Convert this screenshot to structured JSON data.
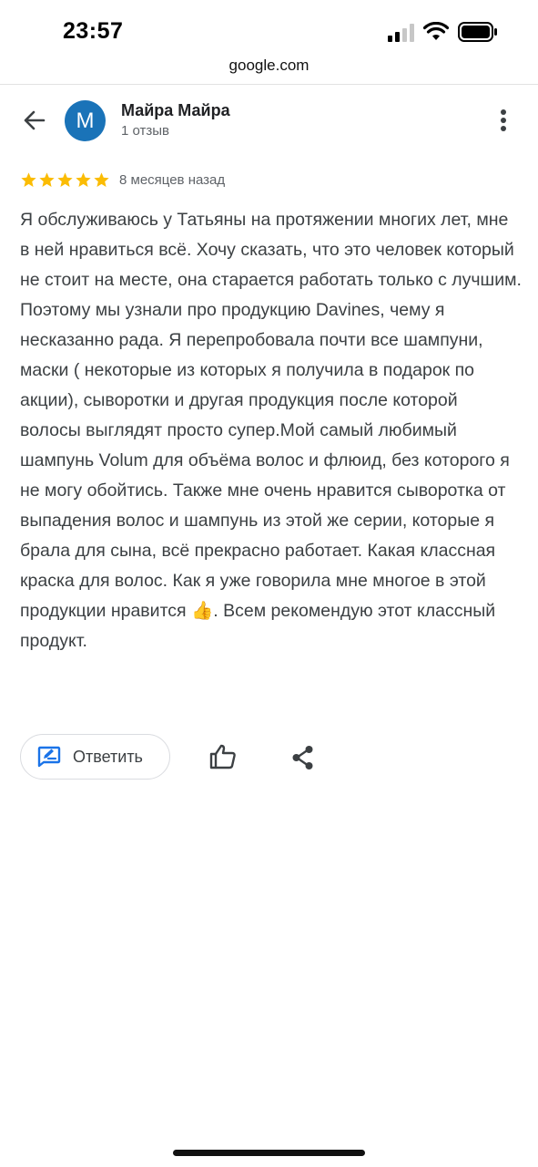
{
  "status_bar": {
    "time": "23:57",
    "icons": [
      "cellular-signal-icon",
      "wifi-icon",
      "battery-icon"
    ]
  },
  "browser": {
    "url": "google.com"
  },
  "reviewer": {
    "avatar_letter": "M",
    "name": "Майра Майра",
    "reviews_count": "1 отзыв",
    "avatar_color": "#1a73b8"
  },
  "review": {
    "rating": 5,
    "max_rating": 5,
    "star_color": "#fbbc04",
    "date": "8 месяцев назад",
    "text": "Я обслуживаюсь у Татьяны на протяжении многих лет, мне в ней нравиться всё. Хочу сказать, что это человек который не стоит на месте, она старается работать только с лучшим. Поэтому мы узнали про продукцию Davines, чему я несказанно рада. Я перепробовала почти все шампуни, маски ( некоторые из которых я получила в подарок по акции), сыворотки и другая продукция после которой волосы выглядят просто супер.Мой самый любимый шампунь Volum для объёма волос и флюид, без которого я не могу обойтись. Также мне очень нравится сыворотка от выпадения волос и шампунь из этой же серии, которые я брала для сына, всё прекрасно работает. Какая классная краска для волос. Как я уже говорила мне многое в этой продукции нравится 👍. Всем рекомендую этот классный продукт."
  },
  "actions": {
    "reply_label": "Ответить",
    "accent_color": "#1a73e8"
  }
}
